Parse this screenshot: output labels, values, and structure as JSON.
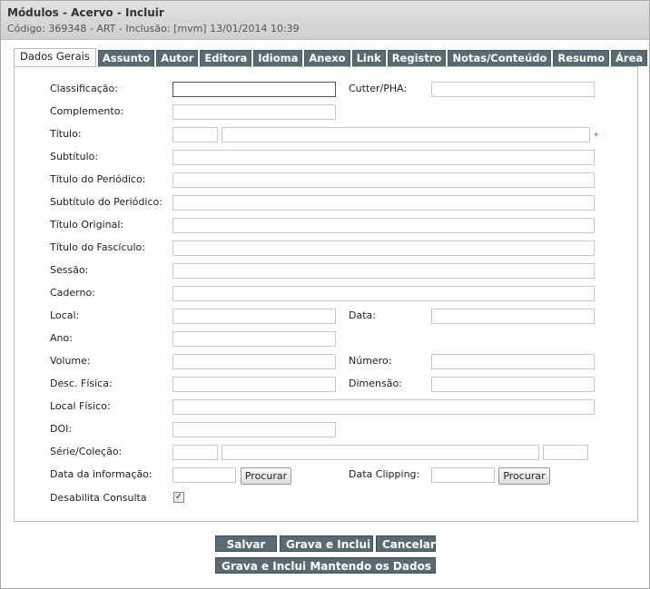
{
  "header": {
    "title": "Módulos - Acervo - Incluir",
    "subtitle": "Código: 369348 - ART - Inclusão: [mvm] 13/01/2014 10:39"
  },
  "tabs": [
    {
      "label": "Dados Gerais"
    },
    {
      "label": "Assunto"
    },
    {
      "label": "Autor"
    },
    {
      "label": "Editora"
    },
    {
      "label": "Idioma"
    },
    {
      "label": "Anexo"
    },
    {
      "label": "Link"
    },
    {
      "label": "Registro"
    },
    {
      "label": "Notas/Conteúdo"
    },
    {
      "label": "Resumo"
    },
    {
      "label": "Área"
    }
  ],
  "form": {
    "classificacao": "Classificação:",
    "cutter": "Cutter/PHA:",
    "complemento": "Complemento:",
    "titulo": "Título:",
    "subtitulo": "Subtítulo:",
    "titulo_periodico": "Título do Periódico:",
    "subtitulo_periodico": "Subtítulo do Periódico:",
    "titulo_original": "Título Original:",
    "titulo_fasciculo": "Título do Fascículo:",
    "sessao": "Sessão:",
    "caderno": "Caderno:",
    "local": "Local:",
    "data": "Data:",
    "ano": "Ano:",
    "volume": "Volume:",
    "numero": "Número:",
    "desc_fisica": "Desc. Física:",
    "dimensao": "Dimensão:",
    "local_fisico": "Local Físico:",
    "doi": "DOI:",
    "serie_colecao": "Série/Coleção:",
    "data_informacao": "Data da informação:",
    "data_clipping": "Data Clipping:",
    "procurar": "Procurar",
    "desabilita_consulta": "Desabilita Consulta",
    "required_mark": "*"
  },
  "actions": {
    "salvar": "Salvar",
    "grava_inclui": "Grava e Inclui",
    "cancelar": "Cancelar",
    "grava_inclui_mantendo": "Grava e Inclui Mantendo os Dados"
  }
}
